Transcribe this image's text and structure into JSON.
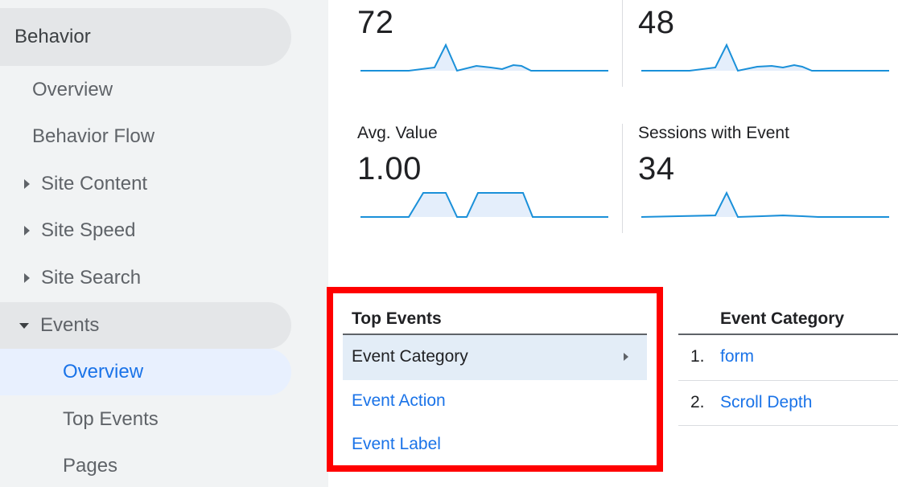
{
  "sidebar": {
    "section": "Behavior",
    "items": [
      {
        "label": "Overview"
      },
      {
        "label": "Behavior Flow"
      },
      {
        "label": "Site Content"
      },
      {
        "label": "Site Speed"
      },
      {
        "label": "Site Search"
      },
      {
        "label": "Events"
      },
      {
        "label": "Overview"
      },
      {
        "label": "Top Events"
      },
      {
        "label": "Pages"
      }
    ]
  },
  "metrics": [
    {
      "title": "",
      "value": "72"
    },
    {
      "title": "",
      "value": "48"
    },
    {
      "title": "Avg. Value",
      "value": "1.00"
    },
    {
      "title": "Sessions with Event",
      "value": "34"
    }
  ],
  "top_events": {
    "header": "Top Events",
    "rows": [
      "Event Category",
      "Event Action",
      "Event Label"
    ]
  },
  "event_table": {
    "header": "Event Category",
    "rows": [
      {
        "num": "1.",
        "label": "form"
      },
      {
        "num": "2.",
        "label": "Scroll Depth"
      }
    ]
  },
  "colors": {
    "accent": "#1a73e8",
    "highlight_border": "#ff0000",
    "sparkline": "#1a90d9"
  }
}
